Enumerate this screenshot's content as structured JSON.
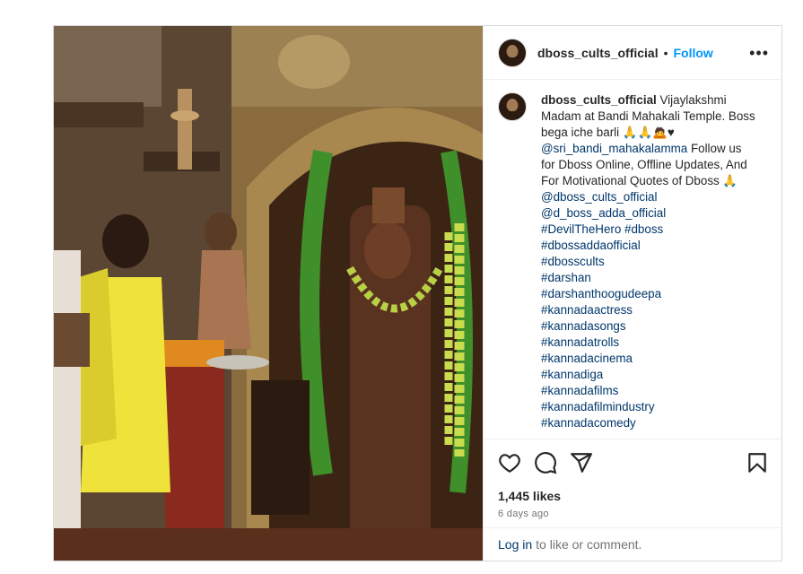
{
  "post": {
    "username": "dboss_cults_official",
    "separator": "•",
    "follow_label": "Follow",
    "more_label": "•••",
    "caption_text": "Vijaylakshmi Madam at Bandi Mahakali Temple. Boss bega iche barli 🙏🙏🙇♥",
    "caption_mention": "@sri_bandi_mahakalamma",
    "caption_text_2": "Follow us for Dboss Online, Offline Updates, And For Motivational Quotes of Dboss 🙏",
    "tags": [
      "@dboss_cults_official",
      "@d_boss_adda_official",
      "#DevilTheHero #dboss",
      "#dbossaddaofficial",
      "#dbosscults",
      "#darshan",
      "#darshanthoogudeepa",
      "#kannadaactress",
      "#kannadasongs",
      "#kannadatrolls",
      "#kannadacinema",
      "#kannadiga",
      "#kannadafilms",
      "#kannadafilmindustry",
      "#kannadacomedy"
    ],
    "likes": "1,445 likes",
    "time": "6 days ago",
    "login_link": "Log in",
    "login_rest": "to like or comment."
  },
  "icons": {
    "like": "heart-icon",
    "comment": "comment-icon",
    "share": "share-icon",
    "save": "bookmark-icon",
    "more": "more-options-icon"
  },
  "colors": {
    "accent": "#0095f6",
    "link": "#00376b",
    "muted": "#737373",
    "border": "#dbdbdb"
  }
}
